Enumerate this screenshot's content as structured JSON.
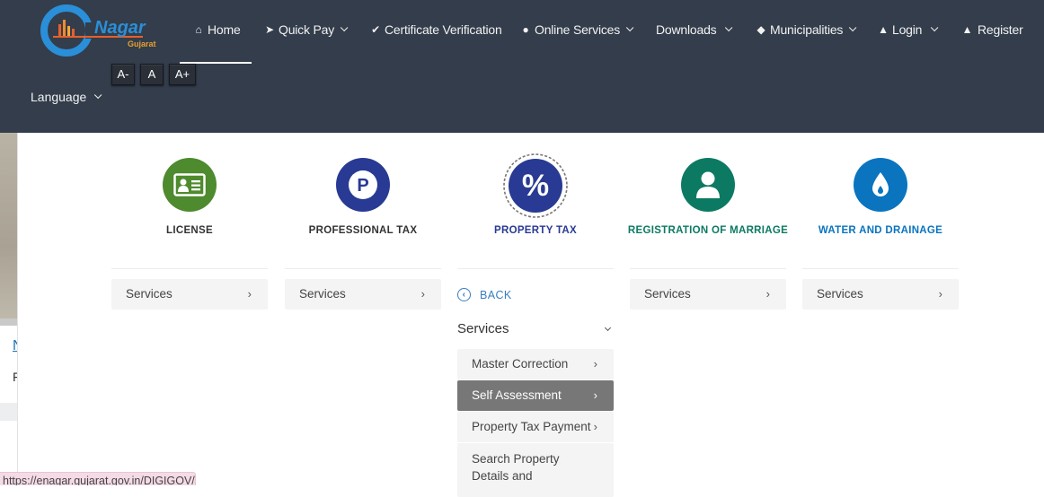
{
  "header": {
    "logo": {
      "name": "e-Nagar",
      "subtitle": "Gujarat"
    },
    "nav": [
      {
        "id": "home",
        "icon": "home-icon",
        "glyph": "⌂",
        "label": "Home",
        "dropdown": false
      },
      {
        "id": "quick-pay",
        "icon": "rocket-icon",
        "glyph": "➤",
        "label": "Quick Pay",
        "dropdown": true
      },
      {
        "id": "certificate-verification",
        "icon": "check-icon",
        "glyph": "✔",
        "label": "Certificate Verification",
        "dropdown": false
      },
      {
        "id": "online-services",
        "icon": "globe-icon",
        "glyph": "●",
        "label": "Online Services",
        "dropdown": true
      },
      {
        "id": "downloads",
        "icon": "",
        "glyph": "",
        "label": "Downloads",
        "dropdown": true
      },
      {
        "id": "municipalities",
        "icon": "tag-icon",
        "glyph": "◆",
        "label": "Municipalities",
        "dropdown": true
      },
      {
        "id": "login",
        "icon": "user-icon",
        "glyph": "▲",
        "label": "Login",
        "dropdown": true
      },
      {
        "id": "register",
        "icon": "user-plus-icon",
        "glyph": "▲",
        "label": "Register",
        "dropdown": false
      }
    ],
    "font_size_buttons": [
      "A-",
      "A",
      "A+"
    ],
    "language_label": "Language"
  },
  "services": [
    {
      "id": "license",
      "title": "LICENSE",
      "color": "#4e8a2e",
      "title_color": "#333333",
      "button": "Services"
    },
    {
      "id": "professional-tax",
      "title": "PROFESSIONAL TAX",
      "color": "#283a93",
      "title_color": "#333333",
      "button": "Services"
    },
    {
      "id": "property-tax",
      "title": "PROPERTY TAX",
      "color": "#283a93",
      "title_color": "#283a93",
      "selected": true
    },
    {
      "id": "registration-of-marriage",
      "title": "REGISTRATION OF MARRIAGE",
      "color": "#0c7a62",
      "title_color": "#0c7a62",
      "button": "Services"
    },
    {
      "id": "water-and-drainage",
      "title": "WATER AND DRAINAGE",
      "color": "#0a74bf",
      "title_color": "#0a74bf",
      "button": "Services"
    }
  ],
  "property_tax_menu": {
    "back_label": "BACK",
    "heading": "Services",
    "items": [
      {
        "label": "Master Correction",
        "active": false
      },
      {
        "label": "Self Assessment",
        "active": true
      },
      {
        "label": "Property Tax Payment",
        "active": false
      },
      {
        "label": "Search Property Details and",
        "active": false
      }
    ]
  },
  "background": {
    "link_fragment": "N",
    "text_fragment": "F"
  },
  "status_bar": {
    "url": "https://enagar.gujarat.gov.in/DIGIGOV/#"
  }
}
